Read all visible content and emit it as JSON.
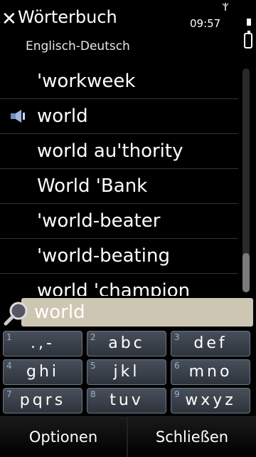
{
  "header": {
    "title": "Wörterbuch",
    "subtitle": "Englisch-Deutsch",
    "time": "09:57"
  },
  "entries": [
    {
      "text": "'workweek",
      "has_audio": false
    },
    {
      "text": "world",
      "has_audio": true
    },
    {
      "text": "world au'thority",
      "has_audio": false
    },
    {
      "text": "World 'Bank",
      "has_audio": false
    },
    {
      "text": "'world-beater",
      "has_audio": false
    },
    {
      "text": "'world-beating",
      "has_audio": false
    },
    {
      "text": "world 'champion",
      "has_audio": false
    }
  ],
  "search": {
    "value": "world"
  },
  "keypad": [
    {
      "num": "1",
      "letters": ".,-"
    },
    {
      "num": "2",
      "letters": "abc"
    },
    {
      "num": "3",
      "letters": "def"
    },
    {
      "num": "4",
      "letters": "ghi"
    },
    {
      "num": "5",
      "letters": "jkl"
    },
    {
      "num": "6",
      "letters": "mno"
    },
    {
      "num": "7",
      "letters": "pqrs"
    },
    {
      "num": "8",
      "letters": "tuv"
    },
    {
      "num": "9",
      "letters": "wxyz"
    }
  ],
  "softkeys": {
    "left": "Optionen",
    "right": "Schließen"
  }
}
